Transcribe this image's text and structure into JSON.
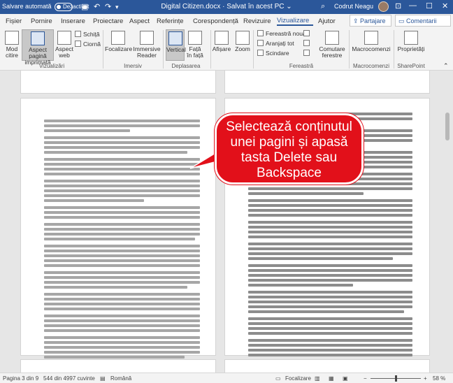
{
  "titlebar": {
    "autosave_label": "Salvare automată",
    "autosave_state": "Dezactivat",
    "doc_title": "Digital Citizen.docx  ·  Salvat în acest PC  ⌄",
    "user_name": "Codrut Neagu",
    "save_icon": "save-icon",
    "undo_icon": "undo-icon",
    "redo_icon": "redo-icon",
    "search_icon": "search-icon",
    "minimize": "—",
    "maximize": "☐",
    "close": "✕"
  },
  "tabs": [
    "Fișier",
    "Pornire",
    "Inserare",
    "Proiectare",
    "Aspect",
    "Referințe",
    "Corespondență",
    "Revizuire",
    "Vizualizare",
    "Ajutor"
  ],
  "active_tab": "Vizualizare",
  "share_label": "Partajare",
  "comments_label": "Comentarii",
  "ribbon": {
    "views": {
      "read_mode": "Mod citire",
      "print_layout": "Aspect pagină imprimată",
      "web_layout": "Aspect web",
      "outline": "Schiță",
      "draft": "Ciornă",
      "group": "Vizualizări"
    },
    "immersive": {
      "focus": "Focalizare",
      "immersive_reader": "Immersive Reader",
      "group": "Imersiv"
    },
    "page_movement": {
      "vertical": "Vertical",
      "side_to_side": "Față în față",
      "group": "Deplasarea paginilor"
    },
    "show": {
      "label": "Afișare"
    },
    "zoom": {
      "label": "Zoom"
    },
    "window": {
      "new_window": "Fereastră nouă",
      "arrange_all": "Aranjați tot",
      "split": "Scindare",
      "switch_windows": "Comutare ferestre",
      "group": "Fereastră"
    },
    "macros": {
      "label": "Macrocomenzi",
      "group": "Macrocomenzi"
    },
    "sharepoint": {
      "properties": "Proprietăți",
      "group": "SharePoint"
    }
  },
  "callout": {
    "text": "Selectează conținutul unei pagini și apasă tasta Delete sau Backspace",
    "color": "#e2101a"
  },
  "statusbar": {
    "page": "Pagina 3 din 9",
    "words": "544 din 4997 cuvinte",
    "language": "Română",
    "focus": "Focalizare",
    "zoom": "58 %",
    "zoom_minus": "−",
    "zoom_plus": "+"
  },
  "colors": {
    "accent": "#2b579a",
    "selection": "#a6a6a6"
  }
}
